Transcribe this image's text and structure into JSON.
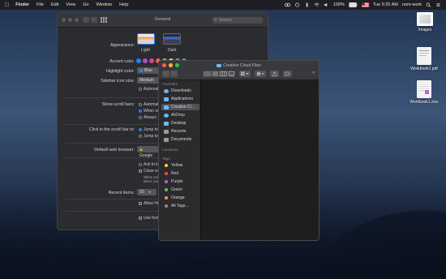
{
  "menubar": {
    "apple": "",
    "items": [
      "Finder",
      "File",
      "Edit",
      "View",
      "Go",
      "Window",
      "Help"
    ],
    "right": {
      "battery": "100%",
      "time": "Tue 9:25 AM",
      "user": "nom-work"
    }
  },
  "desktop": {
    "icons": [
      {
        "label": "Images"
      },
      {
        "label": "Workbook1.pdf"
      },
      {
        "label": "Workbook1.xlsx"
      }
    ]
  },
  "prefs": {
    "title": "General",
    "search_placeholder": "Search",
    "appearance": {
      "label": "Appearance:",
      "options": [
        "Light",
        "Dark"
      ]
    },
    "accent": {
      "label": "Accent color:",
      "colors": [
        "#2f7bf5",
        "#a552c6",
        "#e0468a",
        "#ec5f5d",
        "#f09a36",
        "#f3cc3a",
        "#63b94b",
        "#8e8e93"
      ]
    },
    "highlight": {
      "label": "Highlight color:",
      "value": "Blue"
    },
    "sidebar_icon": {
      "label": "Sidebar icon size:",
      "value": "Medium"
    },
    "auto_label": "Automati",
    "scroll_bars": {
      "label": "Show scroll bars:",
      "options": [
        "Automatic",
        "When sc",
        "Always"
      ]
    },
    "click_scroll": {
      "label": "Click in the scroll bar to:",
      "options": [
        "Jump to",
        "Jump to"
      ]
    },
    "browser": {
      "label": "Default web browser:",
      "value": "Google"
    },
    "ask_keep": "Ask to ke",
    "close_win": "Close win",
    "when_sel": "When sele",
    "when_you": "when you",
    "recent": {
      "label": "Recent items:",
      "value": "10"
    },
    "allow_hand": "Allow Ha",
    "use_font": "Use font"
  },
  "finder": {
    "title": "Creative Cloud Files",
    "sections": {
      "favorites": "Favorites",
      "locations": "Locations",
      "tags": "Tags"
    },
    "favorites": [
      {
        "label": "Downloads",
        "color": "#6fb7ef"
      },
      {
        "label": "Applications",
        "color": "#6fb7ef"
      },
      {
        "label": "Creative Cl...",
        "color": "#6fb7ef"
      },
      {
        "label": "AirDrop",
        "color": "#6fb7ef"
      },
      {
        "label": "Desktop",
        "color": "#6fb7ef"
      },
      {
        "label": "Recents",
        "color": "#9a9a9a"
      },
      {
        "label": "Documents",
        "color": "#9a9a9a"
      }
    ],
    "tags": [
      {
        "label": "Yellow",
        "color": "#f2d13b"
      },
      {
        "label": "Red",
        "color": "#ec4d4d"
      },
      {
        "label": "Purple",
        "color": "#b067d6"
      },
      {
        "label": "Green",
        "color": "#58c254"
      },
      {
        "label": "Orange",
        "color": "#f29b39"
      },
      {
        "label": "All Tags...",
        "color": "#8c8c8c"
      }
    ]
  }
}
